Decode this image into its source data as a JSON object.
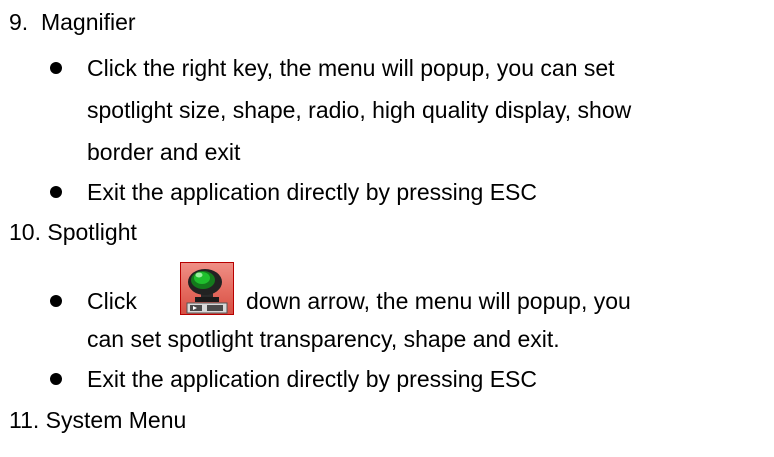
{
  "sections": [
    {
      "number": "9.",
      "title": "Magnifier",
      "bullets": [
        {
          "lines": [
            "Click the right key, the menu will popup, you can set",
            "spotlight size, shape, radio, high quality display, show",
            "border and exit"
          ]
        },
        {
          "lines": [
            "Exit the application directly by pressing ESC"
          ]
        }
      ]
    },
    {
      "number": "10.",
      "title": "Spotlight",
      "bullets": [
        {
          "prefix": "Click",
          "icon": "spotlight-tool-icon",
          "suffix": "down arrow, the menu will popup, you",
          "lines": [
            "can set spotlight transparency, shape and exit."
          ]
        },
        {
          "lines": [
            "Exit the application directly by pressing ESC"
          ]
        }
      ]
    },
    {
      "number": "11.",
      "title": "System Menu"
    }
  ],
  "colors": {
    "text": "#000000",
    "icon_background": "#e46a5e",
    "icon_border": "#b80000",
    "icon_lens": "#1fbf2d"
  }
}
